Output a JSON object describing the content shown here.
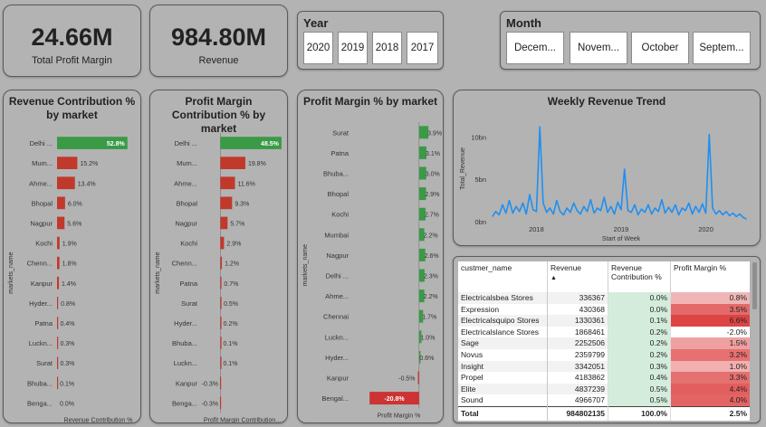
{
  "kpis": [
    {
      "value": "24.66M",
      "label": "Total Profit Margin"
    },
    {
      "value": "984.80M",
      "label": "Revenue"
    }
  ],
  "year_slicer": {
    "title": "Year",
    "options": [
      "2020",
      "2019",
      "2018",
      "2017"
    ]
  },
  "month_slicer": {
    "title": "Month",
    "options": [
      "Decem...",
      "Novem...",
      "October",
      "Septem..."
    ]
  },
  "revenue_contribution": {
    "title": "Revenue Contribution % by market",
    "xlabel": "Revenue Contribution %",
    "ylabel": "markets_name",
    "bar_color": "#c0392b",
    "highlight_color": "#3a9a46",
    "chart_data": {
      "type": "bar",
      "categories": [
        "Delhi ...",
        "Mum...",
        "Ahme...",
        "Bhopal",
        "Nagpur",
        "Kochi",
        "Chenn...",
        "Kanpur",
        "Hyder...",
        "Patna",
        "Luckn...",
        "Surat",
        "Bhuba...",
        "Benga..."
      ],
      "values": [
        52.8,
        15.2,
        13.4,
        6.0,
        5.6,
        1.9,
        1.8,
        1.4,
        0.8,
        0.4,
        0.3,
        0.3,
        0.1,
        0.0
      ],
      "labels": [
        "52.8%",
        "15.2%",
        "13.4%",
        "6.0%",
        "5.6%",
        "1.9%",
        "1.8%",
        "1.4%",
        "0.8%",
        "0.4%",
        "0.3%",
        "0.3%",
        "0.1%",
        "0.0%"
      ],
      "highlight_index": 0,
      "xlim": [
        0,
        55
      ]
    }
  },
  "profit_contribution": {
    "title": "Profit Margin Contribution % by market",
    "xlabel": "Profit Margin Contribution...",
    "ylabel": "markets_name",
    "bar_color": "#c0392b",
    "highlight_color": "#3a9a46",
    "chart_data": {
      "type": "bar",
      "categories": [
        "Delhi ...",
        "Mum...",
        "Ahme...",
        "Bhopal",
        "Nagpur",
        "Kochi",
        "Chenn...",
        "Patna",
        "Surat",
        "Hyder...",
        "Bhuba...",
        "Luckn...",
        "Kanpur",
        "Benga..."
      ],
      "values": [
        48.5,
        19.8,
        11.6,
        9.3,
        5.7,
        2.9,
        1.2,
        0.7,
        0.5,
        0.2,
        0.1,
        0.1,
        -0.3,
        -0.3
      ],
      "labels": [
        "48.5%",
        "19.8%",
        "11.6%",
        "9.3%",
        "5.7%",
        "2.9%",
        "1.2%",
        "0.7%",
        "0.5%",
        "0.2%",
        "0.1%",
        "0.1%",
        "-0.3%",
        "-0.3%"
      ],
      "highlight_index": 0,
      "xlim": [
        -1,
        50
      ]
    }
  },
  "profit_margin_pct": {
    "title": "Profit Margin % by market",
    "xlabel": "Profit Margin %",
    "ylabel": "markets_name",
    "bar_color": "#3a9a46",
    "neg_color": "#cc3333",
    "chart_data": {
      "type": "bar",
      "categories": [
        "Surat",
        "Patna",
        "Bhuba...",
        "Bhopal",
        "Kochi",
        "Mumbai",
        "Nagpur",
        "Delhi ...",
        "Ahme...",
        "Chennai",
        "Luckn...",
        "Hyder...",
        "Kanpur",
        "Bengal..."
      ],
      "values": [
        3.9,
        3.1,
        3.0,
        2.9,
        2.7,
        2.2,
        2.6,
        2.3,
        2.2,
        1.7,
        1.0,
        0.6,
        -0.5,
        -20.8
      ],
      "labels": [
        "3.9%",
        "3.1%",
        "3.0%",
        "2.9%",
        "2.7%",
        "2.2%",
        "2.6%",
        "2.3%",
        "2.2%",
        "1.7%",
        "1.0%",
        "0.6%",
        "-0.5%",
        "-20.8%"
      ],
      "xlim": [
        -22,
        5
      ]
    }
  },
  "weekly_trend": {
    "title": "Weekly Revenue Trend",
    "xlabel": "Start of Week",
    "ylabel": "Total_Revenue",
    "line_color": "#1f8ff0",
    "chart_data": {
      "type": "line",
      "y_ticks": [
        {
          "v": 0,
          "label": "0bn"
        },
        {
          "v": 5,
          "label": "5bn"
        },
        {
          "v": 10,
          "label": "10bn"
        }
      ],
      "x_ticks": [
        {
          "v": 2018.0,
          "label": "2018"
        },
        {
          "v": 2019.0,
          "label": "2019"
        },
        {
          "v": 2020.0,
          "label": "2020"
        }
      ],
      "xlim": [
        2017.45,
        2020.55
      ],
      "ylim": [
        0,
        12.5
      ],
      "x": [
        2017.48,
        2017.52,
        2017.56,
        2017.6,
        2017.64,
        2017.68,
        2017.72,
        2017.76,
        2017.8,
        2017.84,
        2017.88,
        2017.92,
        2017.96,
        2018.0,
        2018.04,
        2018.08,
        2018.12,
        2018.16,
        2018.2,
        2018.24,
        2018.28,
        2018.32,
        2018.36,
        2018.4,
        2018.44,
        2018.48,
        2018.52,
        2018.56,
        2018.6,
        2018.64,
        2018.68,
        2018.72,
        2018.76,
        2018.8,
        2018.84,
        2018.88,
        2018.92,
        2018.96,
        2019.0,
        2019.04,
        2019.08,
        2019.12,
        2019.16,
        2019.2,
        2019.24,
        2019.28,
        2019.32,
        2019.36,
        2019.4,
        2019.44,
        2019.48,
        2019.52,
        2019.56,
        2019.6,
        2019.64,
        2019.68,
        2019.72,
        2019.76,
        2019.8,
        2019.84,
        2019.88,
        2019.92,
        2019.96,
        2020.0,
        2020.04,
        2020.08,
        2020.12,
        2020.16,
        2020.2,
        2020.24,
        2020.28,
        2020.32,
        2020.36,
        2020.4,
        2020.44,
        2020.48
      ],
      "y": [
        0.6,
        1.2,
        0.8,
        2.0,
        1.0,
        2.5,
        1.0,
        1.8,
        1.2,
        2.2,
        0.9,
        3.2,
        1.4,
        1.2,
        11.2,
        2.2,
        1.1,
        1.6,
        0.9,
        2.5,
        1.2,
        0.8,
        1.6,
        1.1,
        2.2,
        1.3,
        0.9,
        1.8,
        1.2,
        2.6,
        1.0,
        1.6,
        1.3,
        2.9,
        1.1,
        1.8,
        0.9,
        2.3,
        1.4,
        6.2,
        1.3,
        1.1,
        2.0,
        0.8,
        1.5,
        1.1,
        2.0,
        0.9,
        1.6,
        1.2,
        2.6,
        1.0,
        1.7,
        1.1,
        2.0,
        0.8,
        1.6,
        1.3,
        2.2,
        0.9,
        1.8,
        1.1,
        2.1,
        1.0,
        10.3,
        1.6,
        0.9,
        1.3,
        0.8,
        1.2,
        0.7,
        1.0,
        0.6,
        0.9,
        0.5,
        0.3
      ]
    }
  },
  "table": {
    "headers": [
      "custmer_name",
      "Revenue",
      "Revenue Contribution %",
      "Profit Margin %"
    ],
    "rows": [
      {
        "name": "Electricalsbea Stores",
        "revenue": "336367",
        "contrib": "0.0%",
        "pm": "0.8%",
        "pm_color": "#f0b6b6"
      },
      {
        "name": "Expression",
        "revenue": "430368",
        "contrib": "0.0%",
        "pm": "3.5%",
        "pm_color": "#e46a6a"
      },
      {
        "name": "Electricalsquipo Stores",
        "revenue": "1330361",
        "contrib": "0.1%",
        "pm": "6.6%",
        "pm_color": "#dd4444"
      },
      {
        "name": "Electricalslance Stores",
        "revenue": "1868461",
        "contrib": "0.2%",
        "pm": "-2.0%",
        "pm_color": "#ffffff"
      },
      {
        "name": "Sage",
        "revenue": "2252506",
        "contrib": "0.2%",
        "pm": "1.5%",
        "pm_color": "#eea0a0"
      },
      {
        "name": "Novus",
        "revenue": "2359799",
        "contrib": "0.2%",
        "pm": "3.2%",
        "pm_color": "#e77070"
      },
      {
        "name": "Insight",
        "revenue": "3342051",
        "contrib": "0.3%",
        "pm": "1.0%",
        "pm_color": "#f2b0b0"
      },
      {
        "name": "Propel",
        "revenue": "4183862",
        "contrib": "0.4%",
        "pm": "3.3%",
        "pm_color": "#e57070"
      },
      {
        "name": "Elite",
        "revenue": "4837239",
        "contrib": "0.5%",
        "pm": "4.4%",
        "pm_color": "#e35e5e"
      },
      {
        "name": "Sound",
        "revenue": "4966707",
        "contrib": "0.5%",
        "pm": "4.0%",
        "pm_color": "#e46464"
      }
    ],
    "total": {
      "name": "Total",
      "revenue": "984802135",
      "contrib": "100.0%",
      "pm": "2.5%"
    },
    "contrib_bg": "#d4ecdc",
    "sort_icon": "sort-ascending-icon"
  }
}
